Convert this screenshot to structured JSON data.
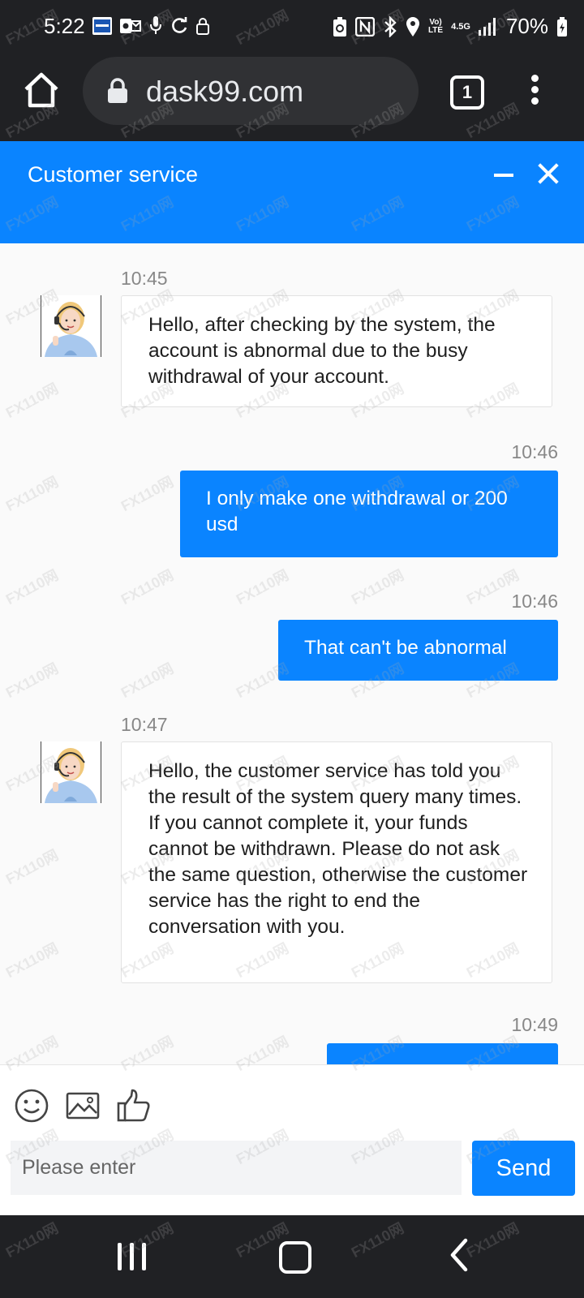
{
  "status_bar": {
    "time": "5:22",
    "left_icons": [
      "bank-card-icon",
      "outlook-icon",
      "microphone-icon",
      "sync-icon",
      "lock-icon"
    ],
    "right_icons": [
      "battery-saver-icon",
      "nfc-icon",
      "bluetooth-icon",
      "location-icon"
    ],
    "network_top": "Vo)",
    "network_bottom": "LTE",
    "net_gen": "4.5G",
    "battery": "70%"
  },
  "browser": {
    "url": "dask99.com",
    "tab_count": "1"
  },
  "chat": {
    "title": "Customer service",
    "messages": [
      {
        "side": "in",
        "time": "10:45",
        "text": "Hello, after checking by the system, the account is abnormal due to the busy withdrawal of your account."
      },
      {
        "side": "out",
        "time": "10:46",
        "text": "I only make one withdrawal or 200 usd"
      },
      {
        "side": "out",
        "time": "10:46",
        "text": "That can't be abnormal"
      },
      {
        "side": "in",
        "time": "10:47",
        "text": "Hello, the customer service has told you the result of the system query many times. If you cannot complete it, your funds cannot be withdrawn. Please do not ask the same question, otherwise the customer service has the right to end the conversation with you."
      },
      {
        "side": "out",
        "time": "10:49",
        "text": ""
      }
    ]
  },
  "input": {
    "placeholder": "Please enter",
    "send_label": "Send",
    "tools": [
      "emoji-icon",
      "image-icon",
      "thumbs-up-icon"
    ]
  },
  "watermark": "FX110网",
  "colors": {
    "accent": "#0a84ff",
    "chrome_dark": "#202124",
    "url_bg": "#303134"
  }
}
